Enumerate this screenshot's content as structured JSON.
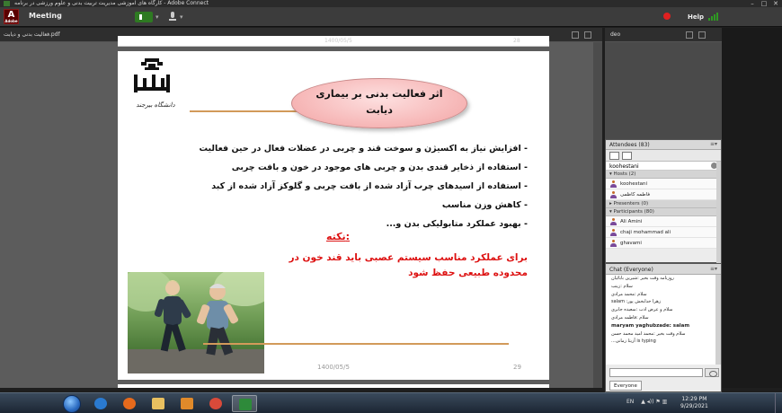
{
  "window": {
    "title": "کارگاه های آموزشی مدیریت تربیت بدنی و علوم ورزشی در برنامه - Adobe Connect",
    "minimize": "–",
    "maximize": "□",
    "close": "✕"
  },
  "menubar": {
    "logo_letter": "A",
    "logo_caption": "Adobe",
    "meeting_label": "Meeting",
    "help_label": "Help",
    "caret": "▾",
    "accent_color": "#2e7a22",
    "record_color": "#e02020"
  },
  "share_pod": {
    "title": "فعالیت بدنی و دیابت.pdf",
    "prev_page_date": "1400/05/5",
    "prev_page_number": "28"
  },
  "slide": {
    "university_caption": "دانشگاه بیرجند",
    "heading_line1": "اثر فعالیت بدنی بر بیماری",
    "heading_line2": "دیابت",
    "bullets": [
      "- افزایش نیاز به اکسیژن و سوخت قند و چربی در عضلات فعال در حین فعالیت",
      "- استفاده از ذخایر قندی بدن  و چربی های موجود در خون و بافت چربی",
      "- استفاده از اسیدهای چرب آزاد شده از بافت چربی و گلوکز آزاد شده از کبد",
      "- کاهش وزن مناسب",
      "- بهبود عملکرد متابولیکی بدن و..."
    ],
    "note_title": "نکته:",
    "note_text": "برای عملکرد مناسب سیستم عصبی باید قند خون در محدوده طبیعی حفظ شود",
    "date": "1400/05/5",
    "page_number": "29",
    "accent_color": "#d11111"
  },
  "video_pod": {
    "title": "deo"
  },
  "attendees": {
    "title": "Attendees  (83)",
    "selected_user": "koohestani",
    "hosts_label": "Hosts (2)",
    "hosts": [
      "koohestani",
      "فاطمه کاظمی"
    ],
    "presenters_label": "Presenters (0)",
    "participants_label": "Participants (80)",
    "participants": [
      "Ali Amini",
      "chaji mohammad ali",
      "ghavami"
    ]
  },
  "chat": {
    "title": "Chat  (Everyone)",
    "messages": [
      "روزنامه وقت بخیر :شیرین بابائیان",
      "سلام :زینب",
      "سلام :محمد مرادی",
      "salam :زهرا خدابخش پور",
      "سلام و عرض ادب :سعیده جابری",
      "سلام :فاطمه مرادی",
      "maryam yaghubzade:  salam",
      "سلام وقت بخیر :محمد امید محمد حسن",
      "...آزیتا زمانی is typing"
    ],
    "tab_label": "Everyone"
  },
  "taskbar": {
    "lang": "EN",
    "tray_icons": "▲  ◂))  ⚑  ▥",
    "time": "12:29 PM",
    "date": "9/29/2021"
  }
}
